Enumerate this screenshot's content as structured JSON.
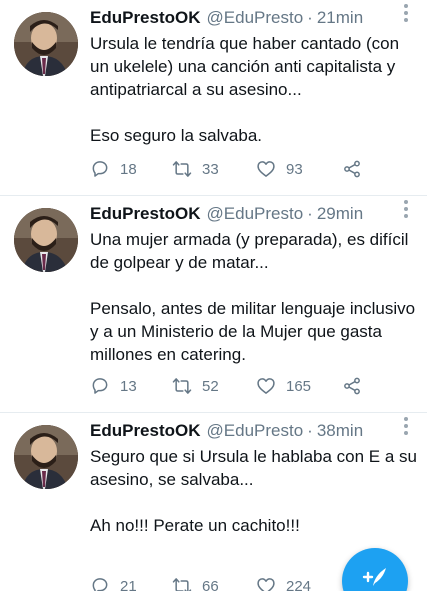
{
  "colors": {
    "accent": "#1da1f2",
    "muted": "#657786",
    "text": "#0f1419",
    "divider": "#e6ecf0"
  },
  "icons": {
    "reply": "reply-icon",
    "retweet": "retweet-icon",
    "like": "heart-icon",
    "share": "share-icon",
    "menu": "more-icon",
    "compose": "compose-icon"
  },
  "tweets": [
    {
      "name": "EduPrestoOK",
      "handle": "@EduPresto",
      "separator": "·",
      "time": "21min",
      "text": "Ursula le tendría que haber cantado (con un ukelele) una canción anti capitalista y antipatriarcal a su asesino...\n\nEso seguro la salvaba.",
      "replies": "18",
      "retweets": "33",
      "likes": "93"
    },
    {
      "name": "EduPrestoOK",
      "handle": "@EduPresto",
      "separator": "·",
      "time": "29min",
      "text": "Una mujer armada (y preparada), es difícil de golpear y de matar...\n\nPensalo, antes de militar lenguaje inclusivo y a un Ministerio de la Mujer que gasta millones en catering.",
      "replies": "13",
      "retweets": "52",
      "likes": "165"
    },
    {
      "name": "EduPrestoOK",
      "handle": "@EduPresto",
      "separator": "·",
      "time": "38min",
      "text": "Seguro que si Ursula le hablaba con E a su asesino, se salvaba...\n\nAh no!!! Perate un cachito!!!",
      "replies": "21",
      "retweets": "66",
      "likes": "224"
    }
  ]
}
